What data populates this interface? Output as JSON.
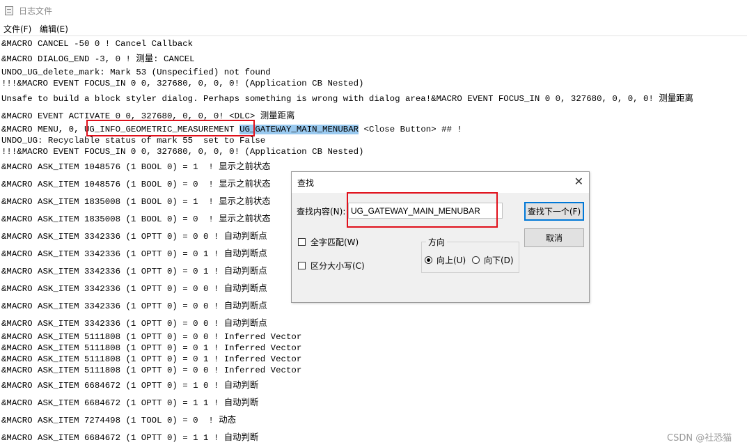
{
  "window": {
    "title": "日志文件"
  },
  "menu": {
    "file": "文件(F)",
    "edit": "编辑(E)"
  },
  "log": {
    "lines": [
      "&MACRO CANCEL -50 0 ! Cancel Callback",
      "&MACRO DIALOG_END -3, 0 ! 测量: CANCEL",
      "UNDO_UG_delete_mark: Mark 53 (Unspecified) not found",
      "!!!&MACRO EVENT FOCUS_IN 0 0, 327680, 0, 0, 0! (Application CB Nested)",
      "Unsafe to build a block styler dialog. Perhaps something is wrong with dialog area!&MACRO EVENT FOCUS_IN 0 0, 327680, 0, 0, 0! 测量距离",
      "&MACRO EVENT ACTIVATE 0 0, 327680, 0, 0, 0! <DLC> 测量距离",
      "UNDO_UG: Recyclable status of mark 55  set to False",
      "!!!&MACRO EVENT FOCUS_IN 0 0, 327680, 0, 0, 0! (Application CB Nested)",
      "&MACRO ASK_ITEM 1048576 (1 BOOL 0) = 1  ! 显示之前状态",
      "&MACRO ASK_ITEM 1048576 (1 BOOL 0) = 0  ! 显示之前状态",
      "&MACRO ASK_ITEM 1835008 (1 BOOL 0) = 1  ! 显示之前状态",
      "&MACRO ASK_ITEM 1835008 (1 BOOL 0) = 0  ! 显示之前状态",
      "&MACRO ASK_ITEM 3342336 (1 OPTT 0) = 0 0 ! 自动判断点",
      "&MACRO ASK_ITEM 3342336 (1 OPTT 0) = 0 1 ! 自动判断点",
      "&MACRO ASK_ITEM 3342336 (1 OPTT 0) = 0 1 ! 自动判断点",
      "&MACRO ASK_ITEM 3342336 (1 OPTT 0) = 0 0 ! 自动判断点",
      "&MACRO ASK_ITEM 3342336 (1 OPTT 0) = 0 0 ! 自动判断点",
      "&MACRO ASK_ITEM 3342336 (1 OPTT 0) = 0 0 ! 自动判断点",
      "&MACRO ASK_ITEM 5111808 (1 OPTT 0) = 0 0 ! Inferred Vector",
      "&MACRO ASK_ITEM 5111808 (1 OPTT 0) = 0 1 ! Inferred Vector",
      "&MACRO ASK_ITEM 5111808 (1 OPTT 0) = 0 1 ! Inferred Vector",
      "&MACRO ASK_ITEM 5111808 (1 OPTT 0) = 0 0 ! Inferred Vector",
      "&MACRO ASK_ITEM 6684672 (1 OPTT 0) = 1 0 ! 自动判断",
      "&MACRO ASK_ITEM 6684672 (1 OPTT 0) = 1 1 ! 自动判断",
      "&MACRO ASK_ITEM 7274498 (1 TOOL 0) = 0  ! 动态",
      "&MACRO ASK_ITEM 6684672 (1 OPTT 0) = 1 1 ! 自动判断"
    ],
    "menu_line": {
      "prefix": "&MACRO MENU, 0, ",
      "boxed": "UG_INFO_GEOMETRIC_MEASUREMENT",
      "highlight": "UG_GATEWAY_MAIN_MENUBAR",
      "suffix": " <Close Button> ## !"
    }
  },
  "find_dialog": {
    "title": "查找",
    "label": "查找内容(N):",
    "value": "UG_GATEWAY_MAIN_MENUBAR",
    "find_next": "查找下一个(F)",
    "cancel": "取消",
    "match_whole_word": "全字匹配(W)",
    "match_case": "区分大小写(C)",
    "direction": "方向",
    "up": "向上(U)",
    "down": "向下(D)",
    "direction_selected": "up"
  },
  "watermark": "CSDN @社恐猫"
}
